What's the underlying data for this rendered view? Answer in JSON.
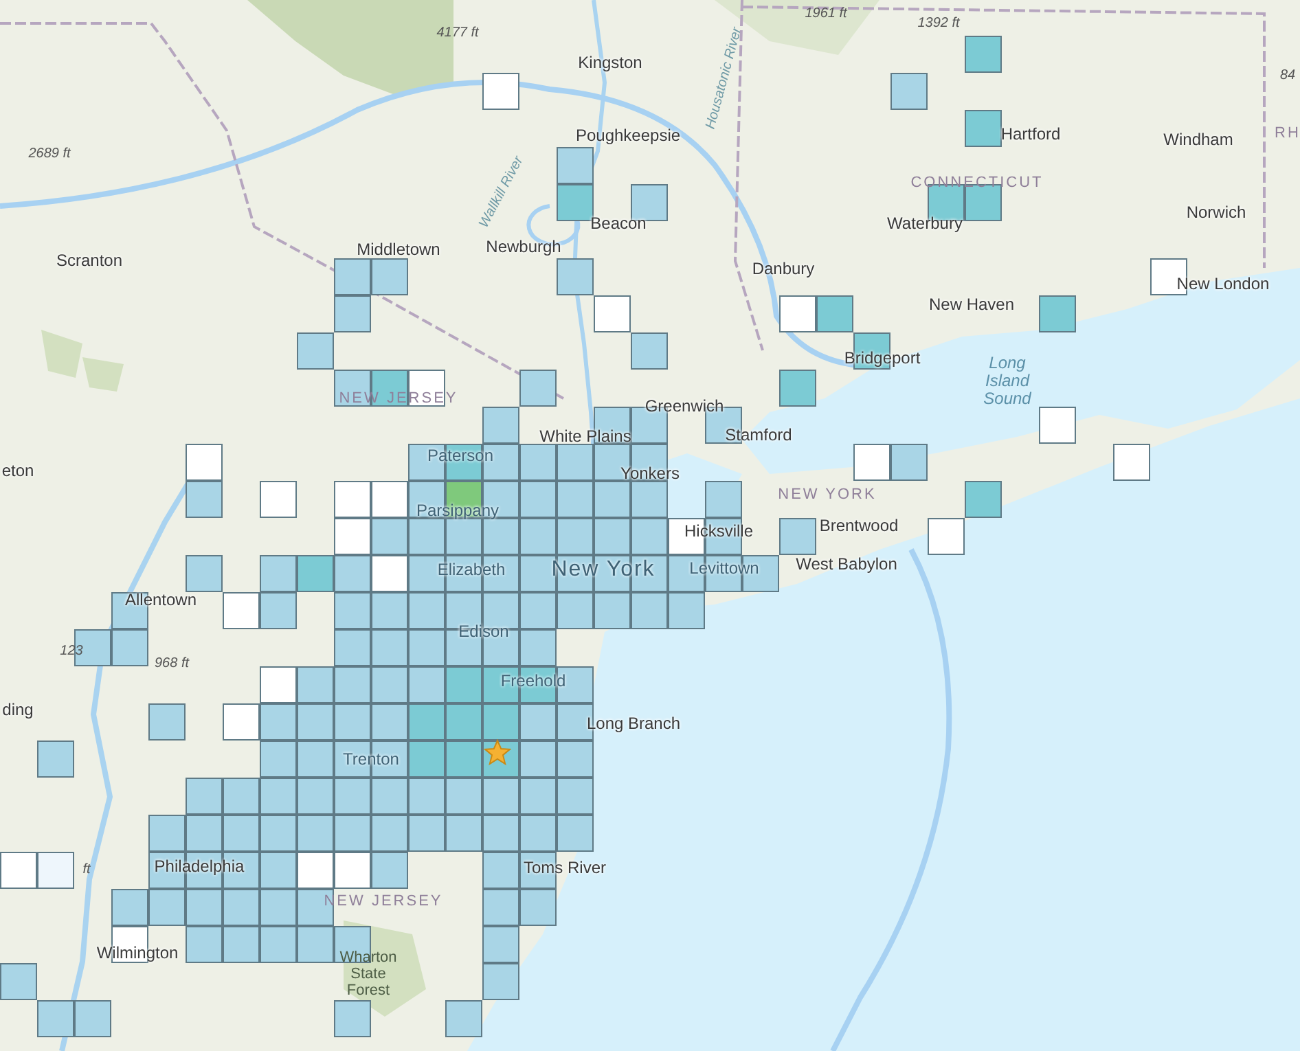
{
  "map_labels": [
    {
      "text": "4177 ft",
      "kind": "elevation"
    },
    {
      "text": "Kingston",
      "kind": "city"
    },
    {
      "text": "1961 ft",
      "kind": "elevation"
    },
    {
      "text": "1392 ft",
      "kind": "elevation"
    },
    {
      "text": "Housatonic River",
      "kind": "river"
    },
    {
      "text": "84",
      "kind": "elevation"
    },
    {
      "text": "2689 ft",
      "kind": "elevation"
    },
    {
      "text": "Poughkeepsie",
      "kind": "city"
    },
    {
      "text": "Wallkill River",
      "kind": "river"
    },
    {
      "text": "Hartford",
      "kind": "city"
    },
    {
      "text": "Windham",
      "kind": "city"
    },
    {
      "text": "RH",
      "kind": "state"
    },
    {
      "text": "CONNECTICUT",
      "kind": "state"
    },
    {
      "text": "Waterbury",
      "kind": "city"
    },
    {
      "text": "Norwich",
      "kind": "city"
    },
    {
      "text": "Beacon",
      "kind": "city"
    },
    {
      "text": "Scranton",
      "kind": "city"
    },
    {
      "text": "Middletown",
      "kind": "city"
    },
    {
      "text": "Newburgh",
      "kind": "city"
    },
    {
      "text": "Danbury",
      "kind": "city"
    },
    {
      "text": "New London",
      "kind": "city"
    },
    {
      "text": "New Haven",
      "kind": "city"
    },
    {
      "text": "Bridgeport",
      "kind": "city"
    },
    {
      "text": "NEW JERSEY",
      "kind": "state"
    },
    {
      "text": "Greenwich",
      "kind": "city"
    },
    {
      "text": "Long Island Sound",
      "kind": "water"
    },
    {
      "text": "White Plains",
      "kind": "city"
    },
    {
      "text": "Stamford",
      "kind": "city"
    },
    {
      "text": "Paterson",
      "kind": "faint"
    },
    {
      "text": "Yonkers",
      "kind": "city"
    },
    {
      "text": "eton",
      "kind": "city"
    },
    {
      "text": "NEW YORK",
      "kind": "state"
    },
    {
      "text": "Brentwood",
      "kind": "city"
    },
    {
      "text": "Parsippany",
      "kind": "faint"
    },
    {
      "text": "Hicksville",
      "kind": "city"
    },
    {
      "text": "Elizabeth",
      "kind": "faint"
    },
    {
      "text": "New York",
      "kind": "metro"
    },
    {
      "text": "Levittown",
      "kind": "faint"
    },
    {
      "text": "West Babylon",
      "kind": "city"
    },
    {
      "text": "Allentown",
      "kind": "city"
    },
    {
      "text": "Edison",
      "kind": "faint"
    },
    {
      "text": "123",
      "kind": "elevation"
    },
    {
      "text": "968 ft",
      "kind": "elevation"
    },
    {
      "text": "ding",
      "kind": "city"
    },
    {
      "text": "Freehold",
      "kind": "faint"
    },
    {
      "text": "Long Branch",
      "kind": "city"
    },
    {
      "text": "Trenton",
      "kind": "faint"
    },
    {
      "text": "ft",
      "kind": "elevation"
    },
    {
      "text": "Philadelphia",
      "kind": "city"
    },
    {
      "text": "Toms River",
      "kind": "city"
    },
    {
      "text": "NEW JERSEY",
      "kind": "state"
    },
    {
      "text": "Wilmington",
      "kind": "city"
    },
    {
      "text": "Wharton State Forest",
      "kind": "park"
    }
  ],
  "intensity_grid": {
    "rows": [
      [],
      [
        null,
        null,
        null,
        null,
        null,
        null,
        null,
        null,
        null,
        null,
        null,
        null,
        null,
        null,
        null,
        null,
        null,
        null,
        null,
        null,
        null,
        null,
        null,
        null,
        null,
        null,
        {
          "color": "#7ccbd4"
        }
      ],
      [
        null,
        null,
        null,
        null,
        null,
        null,
        null,
        null,
        null,
        null,
        null,
        null,
        null,
        {
          "color": "#ffffff"
        },
        null,
        null,
        null,
        null,
        null,
        null,
        null,
        null,
        null,
        null,
        {
          "color": "#a9d5e6"
        }
      ],
      [
        null,
        null,
        null,
        null,
        null,
        null,
        null,
        null,
        null,
        null,
        null,
        null,
        null,
        null,
        null,
        null,
        null,
        null,
        null,
        null,
        null,
        null,
        null,
        null,
        null,
        null,
        {
          "color": "#7ccbd4"
        }
      ],
      [
        null,
        null,
        null,
        null,
        null,
        null,
        null,
        null,
        null,
        null,
        null,
        null,
        null,
        null,
        null,
        {
          "color": "#a9d5e6"
        }
      ],
      [
        null,
        null,
        null,
        null,
        null,
        null,
        null,
        null,
        null,
        null,
        null,
        null,
        null,
        null,
        null,
        {
          "color": "#7ccbd4"
        },
        null,
        {
          "color": "#a9d5e6"
        },
        null,
        null,
        null,
        null,
        null,
        null,
        null,
        {
          "color": "#7ccbd4"
        },
        {
          "color": "#7ccbd4"
        }
      ],
      [],
      [
        null,
        null,
        null,
        null,
        null,
        null,
        null,
        null,
        null,
        {
          "color": "#a9d5e6"
        },
        {
          "color": "#a9d5e6"
        },
        null,
        null,
        null,
        null,
        {
          "color": "#a9d5e6"
        },
        null,
        null,
        null,
        null,
        null,
        null,
        null,
        null,
        null,
        null,
        null,
        null,
        null,
        null,
        null,
        {
          "color": "#ffffff"
        }
      ],
      [
        null,
        null,
        null,
        null,
        null,
        null,
        null,
        null,
        null,
        {
          "color": "#a9d5e6"
        },
        null,
        null,
        null,
        null,
        null,
        null,
        {
          "color": "#ffffff"
        },
        null,
        null,
        null,
        null,
        {
          "color": "#ffffff"
        },
        {
          "color": "#7ccbd4"
        },
        null,
        null,
        null,
        null,
        null,
        {
          "color": "#7ccbd4"
        }
      ],
      [
        null,
        null,
        null,
        null,
        null,
        null,
        null,
        null,
        {
          "color": "#a9d5e6"
        },
        null,
        null,
        null,
        null,
        null,
        null,
        null,
        null,
        {
          "color": "#a9d5e6"
        },
        null,
        null,
        null,
        null,
        null,
        {
          "color": "#7ccbd4"
        }
      ],
      [
        null,
        null,
        null,
        null,
        null,
        null,
        null,
        null,
        null,
        {
          "color": "#a9d5e6"
        },
        {
          "color": "#7ccbd4"
        },
        {
          "color": "#ffffff"
        },
        null,
        null,
        {
          "color": "#a9d5e6"
        },
        null,
        null,
        null,
        null,
        null,
        null,
        {
          "color": "#7ccbd4"
        }
      ],
      [
        null,
        null,
        null,
        null,
        null,
        null,
        null,
        null,
        null,
        null,
        null,
        null,
        null,
        {
          "color": "#a9d5e6"
        },
        null,
        null,
        {
          "color": "#a9d5e6"
        },
        {
          "color": "#a9d5e6"
        },
        null,
        {
          "color": "#a9d5e6"
        },
        null,
        null,
        null,
        null,
        null,
        null,
        null,
        null,
        {
          "color": "#ffffff"
        }
      ],
      [
        null,
        null,
        null,
        null,
        null,
        {
          "color": "#ffffff"
        },
        null,
        null,
        null,
        null,
        null,
        {
          "color": "#a9d5e6"
        },
        {
          "color": "#7ccbd4"
        },
        {
          "color": "#a9d5e6"
        },
        {
          "color": "#a9d5e6"
        },
        {
          "color": "#a9d5e6"
        },
        {
          "color": "#a9d5e6"
        },
        {
          "color": "#a9d5e6"
        },
        null,
        null,
        null,
        null,
        null,
        {
          "color": "#ffffff"
        },
        {
          "color": "#a9d5e6"
        },
        null,
        null,
        null,
        null,
        null,
        {
          "color": "#ffffff"
        }
      ],
      [
        null,
        null,
        null,
        null,
        null,
        {
          "color": "#a9d5e6"
        },
        null,
        {
          "color": "#ffffff"
        },
        null,
        {
          "color": "#ffffff"
        },
        {
          "color": "#ffffff"
        },
        {
          "color": "#a9d5e6"
        },
        {
          "color": "#7fc97c"
        },
        {
          "color": "#a9d5e6"
        },
        {
          "color": "#a9d5e6"
        },
        {
          "color": "#a9d5e6"
        },
        {
          "color": "#a9d5e6"
        },
        {
          "color": "#a9d5e6"
        },
        null,
        {
          "color": "#a9d5e6"
        },
        null,
        null,
        null,
        null,
        null,
        null,
        {
          "color": "#7ccbd4"
        }
      ],
      [
        null,
        null,
        null,
        null,
        null,
        null,
        null,
        null,
        null,
        {
          "color": "#ffffff"
        },
        {
          "color": "#a9d5e6"
        },
        {
          "color": "#a9d5e6"
        },
        {
          "color": "#a9d5e6"
        },
        {
          "color": "#a9d5e6"
        },
        {
          "color": "#a9d5e6"
        },
        {
          "color": "#a9d5e6"
        },
        {
          "color": "#a9d5e6"
        },
        {
          "color": "#a9d5e6"
        },
        {
          "color": "#ffffff"
        },
        {
          "color": "#a9d5e6"
        },
        null,
        {
          "color": "#a9d5e6"
        },
        null,
        null,
        null,
        {
          "color": "#ffffff"
        }
      ],
      [
        null,
        null,
        null,
        null,
        null,
        {
          "color": "#a9d5e6"
        },
        null,
        {
          "color": "#a9d5e6"
        },
        {
          "color": "#7ccbd4"
        },
        {
          "color": "#a9d5e6"
        },
        {
          "color": "#ffffff"
        },
        {
          "color": "#a9d5e6"
        },
        {
          "color": "#a9d5e6"
        },
        {
          "color": "#a9d5e6"
        },
        {
          "color": "#a9d5e6"
        },
        {
          "color": "#a9d5e6"
        },
        {
          "color": "#a9d5e6"
        },
        {
          "color": "#a9d5e6"
        },
        {
          "color": "#a9d5e6"
        },
        {
          "color": "#a9d5e6"
        },
        {
          "color": "#a9d5e6"
        }
      ],
      [
        null,
        null,
        null,
        {
          "color": "#a9d5e6"
        },
        null,
        null,
        {
          "color": "#ffffff"
        },
        {
          "color": "#a9d5e6"
        },
        null,
        {
          "color": "#a9d5e6"
        },
        {
          "color": "#a9d5e6"
        },
        {
          "color": "#a9d5e6"
        },
        {
          "color": "#a9d5e6"
        },
        {
          "color": "#a9d5e6"
        },
        {
          "color": "#a9d5e6"
        },
        {
          "color": "#a9d5e6"
        },
        {
          "color": "#a9d5e6"
        },
        {
          "color": "#a9d5e6"
        },
        {
          "color": "#a9d5e6"
        }
      ],
      [
        null,
        null,
        {
          "color": "#a9d5e6"
        },
        {
          "color": "#a9d5e6"
        },
        null,
        null,
        null,
        null,
        null,
        {
          "color": "#a9d5e6"
        },
        {
          "color": "#a9d5e6"
        },
        {
          "color": "#a9d5e6"
        },
        {
          "color": "#a9d5e6"
        },
        {
          "color": "#a9d5e6"
        },
        {
          "color": "#a9d5e6"
        }
      ],
      [
        null,
        null,
        null,
        null,
        null,
        null,
        null,
        {
          "color": "#ffffff"
        },
        {
          "color": "#a9d5e6"
        },
        {
          "color": "#a9d5e6"
        },
        {
          "color": "#a9d5e6"
        },
        {
          "color": "#a9d5e6"
        },
        {
          "color": "#7ccbd4"
        },
        {
          "color": "#7ccbd4"
        },
        {
          "color": "#7ccbd4"
        },
        {
          "color": "#a9d5e6"
        }
      ],
      [
        null,
        null,
        null,
        null,
        {
          "color": "#a9d5e6"
        },
        null,
        {
          "color": "#ffffff"
        },
        {
          "color": "#a9d5e6"
        },
        {
          "color": "#a9d5e6"
        },
        {
          "color": "#a9d5e6"
        },
        {
          "color": "#a9d5e6"
        },
        {
          "color": "#7ccbd4"
        },
        {
          "color": "#7ccbd4"
        },
        {
          "color": "#7ccbd4"
        },
        {
          "color": "#a9d5e6"
        },
        {
          "color": "#a9d5e6"
        }
      ],
      [
        null,
        {
          "color": "#a9d5e6"
        },
        null,
        null,
        null,
        null,
        null,
        {
          "color": "#a9d5e6"
        },
        {
          "color": "#a9d5e6"
        },
        {
          "color": "#a9d5e6"
        },
        {
          "color": "#a9d5e6"
        },
        {
          "color": "#7ccbd4"
        },
        {
          "color": "#7ccbd4"
        },
        {
          "color": "#7ccbd4"
        },
        {
          "color": "#a9d5e6"
        },
        {
          "color": "#a9d5e6"
        }
      ],
      [
        null,
        null,
        null,
        null,
        null,
        {
          "color": "#a9d5e6"
        },
        {
          "color": "#a9d5e6"
        },
        {
          "color": "#a9d5e6"
        },
        {
          "color": "#a9d5e6"
        },
        {
          "color": "#a9d5e6"
        },
        {
          "color": "#a9d5e6"
        },
        {
          "color": "#a9d5e6"
        },
        {
          "color": "#a9d5e6"
        },
        {
          "color": "#a9d5e6"
        },
        {
          "color": "#a9d5e6"
        },
        {
          "color": "#a9d5e6"
        }
      ],
      [
        null,
        null,
        null,
        null,
        {
          "color": "#a9d5e6"
        },
        {
          "color": "#a9d5e6"
        },
        {
          "color": "#a9d5e6"
        },
        {
          "color": "#a9d5e6"
        },
        {
          "color": "#a9d5e6"
        },
        {
          "color": "#a9d5e6"
        },
        {
          "color": "#a9d5e6"
        },
        {
          "color": "#a9d5e6"
        },
        {
          "color": "#a9d5e6"
        },
        {
          "color": "#a9d5e6"
        },
        {
          "color": "#a9d5e6"
        },
        {
          "color": "#a9d5e6"
        }
      ],
      [
        {
          "color": "#ffffff"
        },
        {
          "color": "#eef6fc"
        },
        null,
        null,
        {
          "color": "#a9d5e6"
        },
        {
          "color": "#a9d5e6"
        },
        {
          "color": "#a9d5e6"
        },
        {
          "color": "#a9d5e6"
        },
        {
          "color": "#ffffff"
        },
        {
          "color": "#ffffff"
        },
        {
          "color": "#a9d5e6"
        },
        null,
        null,
        {
          "color": "#a9d5e6"
        },
        {
          "color": "#a9d5e6"
        }
      ],
      [
        null,
        null,
        null,
        {
          "color": "#a9d5e6"
        },
        {
          "color": "#a9d5e6"
        },
        {
          "color": "#a9d5e6"
        },
        {
          "color": "#a9d5e6"
        },
        {
          "color": "#a9d5e6"
        },
        {
          "color": "#a9d5e6"
        },
        null,
        null,
        null,
        null,
        {
          "color": "#a9d5e6"
        },
        {
          "color": "#a9d5e6"
        }
      ],
      [
        null,
        null,
        null,
        {
          "color": "#ffffff"
        },
        null,
        {
          "color": "#a9d5e6"
        },
        {
          "color": "#a9d5e6"
        },
        {
          "color": "#a9d5e6"
        },
        {
          "color": "#a9d5e6"
        },
        {
          "color": "#a9d5e6"
        },
        null,
        null,
        null,
        {
          "color": "#a9d5e6"
        }
      ],
      [
        {
          "color": "#a9d5e6"
        },
        null,
        null,
        null,
        null,
        null,
        null,
        null,
        null,
        null,
        null,
        null,
        null,
        {
          "color": "#a9d5e6"
        }
      ],
      [
        null,
        {
          "color": "#a9d5e6"
        },
        {
          "color": "#a9d5e6"
        },
        null,
        null,
        null,
        null,
        null,
        null,
        {
          "color": "#a9d5e6"
        },
        null,
        null,
        {
          "color": "#a9d5e6"
        }
      ]
    ]
  }
}
